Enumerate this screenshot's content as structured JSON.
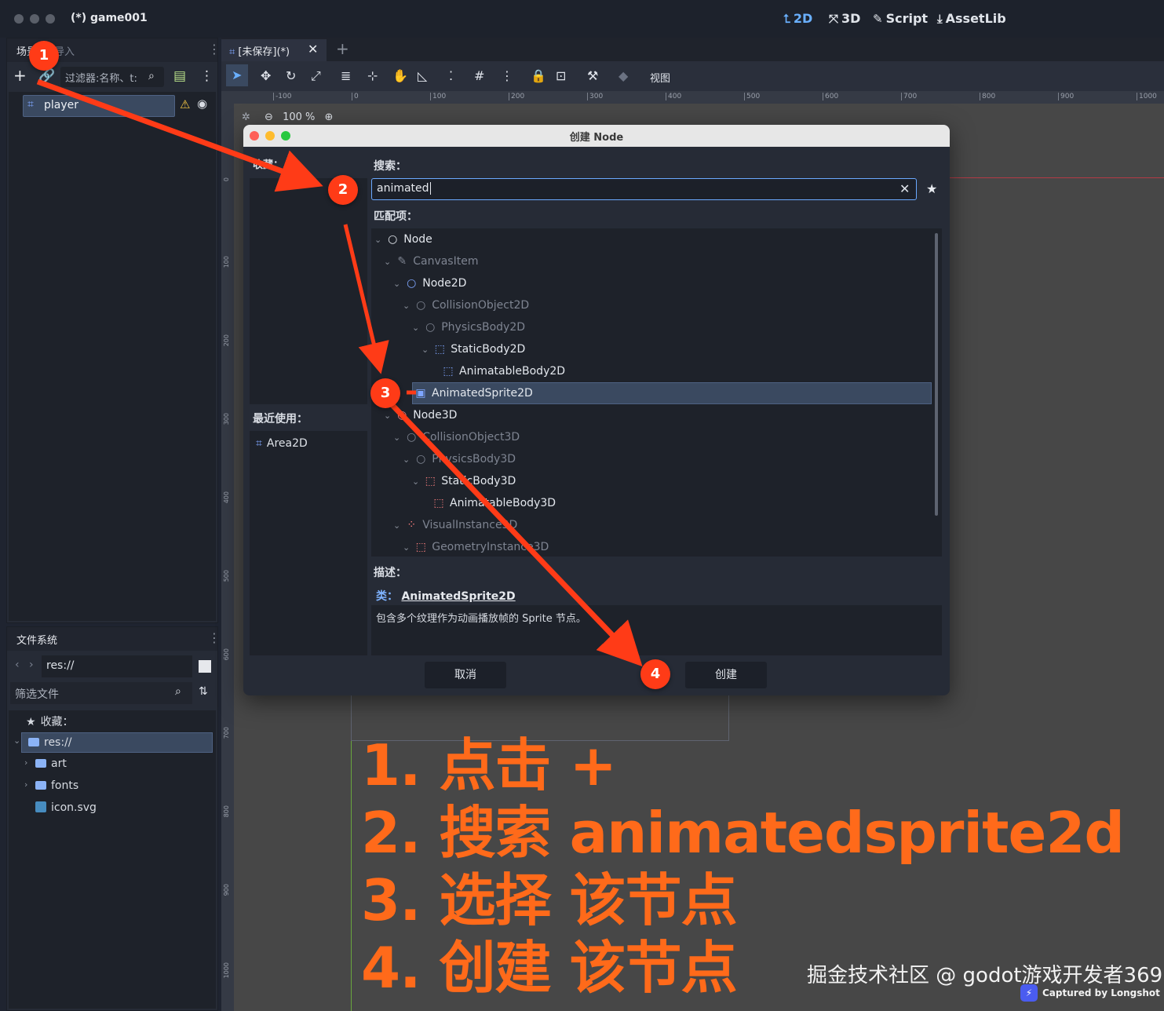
{
  "window": {
    "title": "(*) game001",
    "modes": [
      {
        "label": "2D",
        "icon": "⮤"
      },
      {
        "label": "3D",
        "icon": "⤧"
      },
      {
        "label": "Script",
        "icon": "✎"
      },
      {
        "label": "AssetLib",
        "icon": "⤓"
      }
    ]
  },
  "scene_dock": {
    "tabs": [
      "场景",
      "导入"
    ],
    "filter_placeholder": "过滤器:名称、t:",
    "root_node": "player"
  },
  "fs_dock": {
    "tab": "文件系统",
    "path": "res://",
    "filter_placeholder": "筛选文件",
    "favorites_label": "收藏：",
    "items": [
      "res://",
      "art",
      "fonts",
      "icon.svg"
    ]
  },
  "editor": {
    "tab_label": "[未保存](*)",
    "view_menu": "视图",
    "zoom": "100 %",
    "ruler_ticks": [
      "-100",
      "0",
      "100",
      "200",
      "300",
      "400",
      "500",
      "600",
      "700",
      "800",
      "900",
      "1000"
    ],
    "ruler_left_ticks": [
      "0",
      "100",
      "200",
      "300",
      "400",
      "500",
      "600",
      "700",
      "800",
      "900",
      "1000"
    ]
  },
  "dialog": {
    "title": "创建 Node",
    "favorites_label": "收藏：",
    "search_label": "搜索：",
    "search_value": "animated",
    "matches_label": "匹配项：",
    "recent_label": "最近使用：",
    "recent_items": [
      "Area2D"
    ],
    "tree": [
      {
        "label": "Node",
        "level": 0,
        "dim": false
      },
      {
        "label": "CanvasItem",
        "level": 1,
        "dim": true
      },
      {
        "label": "Node2D",
        "level": 2,
        "dim": false
      },
      {
        "label": "CollisionObject2D",
        "level": 3,
        "dim": true
      },
      {
        "label": "PhysicsBody2D",
        "level": 4,
        "dim": true
      },
      {
        "label": "StaticBody2D",
        "level": 5,
        "dim": false
      },
      {
        "label": "AnimatableBody2D",
        "level": 6,
        "dim": false
      },
      {
        "label": "AnimatedSprite2D",
        "level": 3,
        "dim": false,
        "selected": true
      },
      {
        "label": "Node3D",
        "level": 2,
        "dim": false
      },
      {
        "label": "CollisionObject3D",
        "level": 3,
        "dim": true
      },
      {
        "label": "PhysicsBody3D",
        "level": 4,
        "dim": true
      },
      {
        "label": "StaticBody3D",
        "level": 5,
        "dim": false
      },
      {
        "label": "AnimatableBody3D",
        "level": 6,
        "dim": false
      },
      {
        "label": "VisualInstance3D",
        "level": 3,
        "dim": true
      },
      {
        "label": "GeometryInstance3D",
        "level": 4,
        "dim": true
      }
    ],
    "description_label": "描述：",
    "description_class_prefix": "类：",
    "description_class": "AnimatedSprite2D",
    "description_text": "包含多个纹理作为动画播放帧的 Sprite 节点。",
    "cancel_label": "取消",
    "create_label": "创建"
  },
  "markers": [
    "1",
    "2",
    "3",
    "4"
  ],
  "instructions": [
    "1. 点击 +",
    "2. 搜索 animatedsprite2d",
    "3. 选择 该节点",
    "4. 创建 该节点"
  ],
  "watermark": "掘金技术社区 @ godot游戏开发者369",
  "captured_by": "Captured by Longshot",
  "colors": {
    "accent": "#6ab0ff",
    "selection": "#3a4960",
    "instruction": "#ff6a1a",
    "marker": "#ff3b17"
  }
}
